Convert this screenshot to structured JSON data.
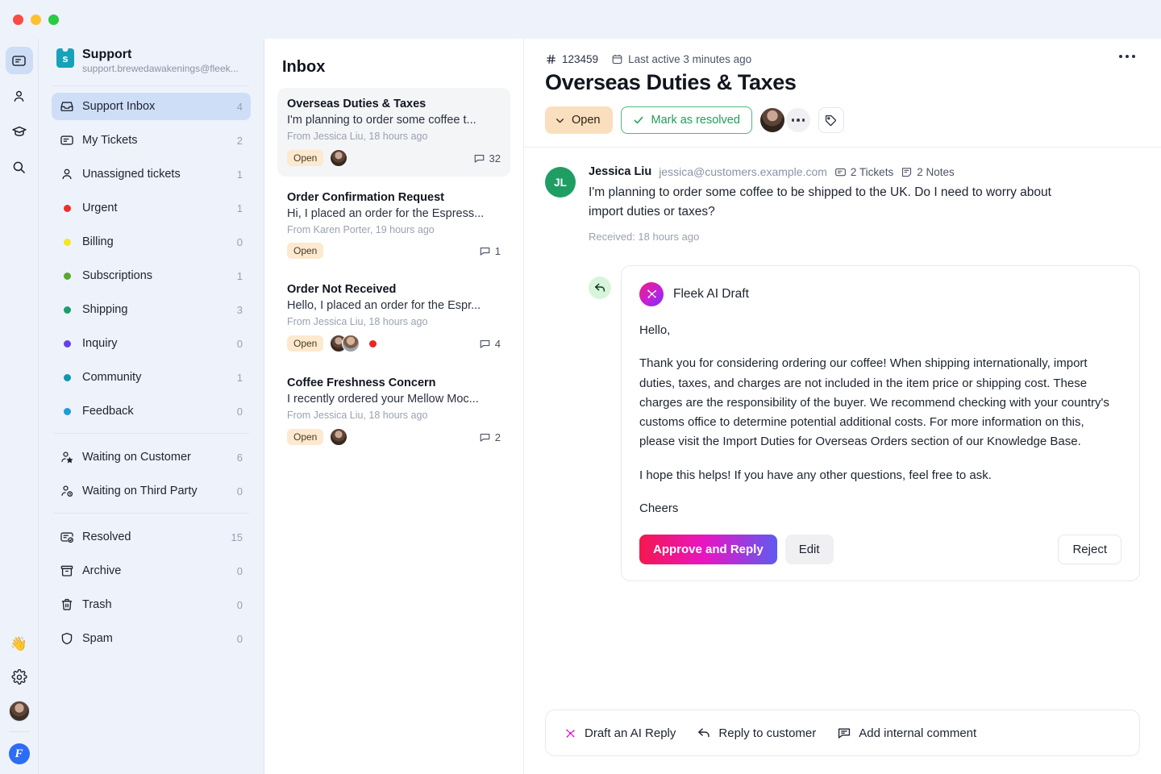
{
  "window": {
    "lights": [
      "close",
      "minimize",
      "zoom"
    ]
  },
  "rail": {
    "items": [
      {
        "name": "inbox",
        "icon": "mail-icon",
        "active": true
      },
      {
        "name": "contacts",
        "icon": "person-icon",
        "active": false
      },
      {
        "name": "knowledge",
        "icon": "graduation-cap-icon",
        "active": false
      },
      {
        "name": "search",
        "icon": "search-icon",
        "active": false
      }
    ],
    "wave_emoji": "👋",
    "settings_icon": "gear-icon",
    "avatar": "user-avatar",
    "logo_letter": "F"
  },
  "workspace": {
    "logo_letter": "s",
    "name": "Support",
    "email": "support.brewedawakenings@fleek..."
  },
  "sidebar": {
    "groups": [
      {
        "items": [
          {
            "label": "Support Inbox",
            "count": "4",
            "icon": "inbox-icon",
            "active": true
          },
          {
            "label": "My Tickets",
            "count": "2",
            "icon": "ticket-icon",
            "active": false
          },
          {
            "label": "Unassigned tickets",
            "count": "1",
            "icon": "person-icon",
            "active": false
          },
          {
            "label": "Urgent",
            "count": "1",
            "dot": "#f02e2e",
            "active": false
          },
          {
            "label": "Billing",
            "count": "0",
            "dot": "#f5e621",
            "active": false
          },
          {
            "label": "Subscriptions",
            "count": "1",
            "dot": "#5ca82e",
            "active": false
          },
          {
            "label": "Shipping",
            "count": "3",
            "dot": "#1a9e6b",
            "active": false
          },
          {
            "label": "Inquiry",
            "count": "0",
            "dot": "#6342e8",
            "active": false
          },
          {
            "label": "Community",
            "count": "1",
            "dot": "#1496b0",
            "active": false
          },
          {
            "label": "Feedback",
            "count": "0",
            "dot": "#1e9bd8",
            "active": false
          }
        ]
      },
      {
        "items": [
          {
            "label": "Waiting on Customer",
            "count": "6",
            "icon": "person-star-icon",
            "active": false
          },
          {
            "label": "Waiting on Third Party",
            "count": "0",
            "icon": "person-clock-icon",
            "active": false
          }
        ]
      },
      {
        "items": [
          {
            "label": "Resolved",
            "count": "15",
            "icon": "ticket-check-icon",
            "active": false
          },
          {
            "label": "Archive",
            "count": "0",
            "icon": "archive-icon",
            "active": false
          },
          {
            "label": "Trash",
            "count": "0",
            "icon": "trash-icon",
            "active": false
          },
          {
            "label": "Spam",
            "count": "0",
            "icon": "shield-icon",
            "active": false
          }
        ]
      }
    ]
  },
  "inbox": {
    "title": "Inbox",
    "threads": [
      {
        "subject": "Overseas Duties & Taxes",
        "preview": "I'm planning to order some coffee t...",
        "from": "From Jessica Liu, 18 hours ago",
        "status": "Open",
        "comments": "32",
        "selected": true,
        "avatars": 1,
        "urgent": false
      },
      {
        "subject": "Order Confirmation Request",
        "preview": "Hi, I placed an order for the Espress...",
        "from": "From Karen Porter, 19 hours ago",
        "status": "Open",
        "comments": "1",
        "selected": false,
        "avatars": 0,
        "urgent": false
      },
      {
        "subject": "Order Not Received",
        "preview": "Hello, I placed an order for the Espr...",
        "from": "From Jessica Liu, 18 hours ago",
        "status": "Open",
        "comments": "4",
        "selected": false,
        "avatars": 2,
        "urgent": true
      },
      {
        "subject": "Coffee Freshness Concern",
        "preview": "I recently ordered your Mellow Moc...",
        "from": "From Jessica Liu, 18 hours ago",
        "status": "Open",
        "comments": "2",
        "selected": false,
        "avatars": 1,
        "urgent": false
      }
    ]
  },
  "ticket": {
    "number": "123459",
    "last_active": "Last active 3 minutes ago",
    "title": "Overseas Duties & Taxes",
    "status_label": "Open",
    "resolve_label": "Mark as resolved"
  },
  "message": {
    "initials": "JL",
    "author": "Jessica Liu",
    "email": "jessica@customers.example.com",
    "tickets_chip": "2 Tickets",
    "notes_chip": "2 Notes",
    "text": "I'm planning to order some coffee to be shipped to the UK. Do I need to worry about import duties or taxes?",
    "received": "Received: 18 hours ago"
  },
  "ai_draft": {
    "title": "Fleek AI Draft",
    "paragraphs": [
      "Hello,",
      "Thank you for considering ordering our coffee! When shipping internationally, import duties, taxes, and charges are not included in the item price or shipping cost. These charges are the responsibility of the buyer. We recommend checking with your country's customs office to determine potential additional costs. For more information on this, please visit the Import Duties for Overseas Orders section of our Knowledge Base.",
      "I hope this helps! If you have any other questions, feel free to ask.",
      "Cheers"
    ],
    "approve_label": "Approve and Reply",
    "edit_label": "Edit",
    "reject_label": "Reject"
  },
  "composer": {
    "draft_ai_label": "Draft an AI Reply",
    "reply_label": "Reply to customer",
    "comment_label": "Add internal comment"
  },
  "colors": {
    "accent_blue": "#2d6cf6",
    "sidebar_bg": "#eef2fb",
    "active_nav": "#cfdef7",
    "open_badge": "#fde9cf",
    "resolve_green": "#1f9e55",
    "gradient_start": "#f5174f",
    "gradient_mid": "#e815c4",
    "gradient_end": "#5e5bf0"
  }
}
